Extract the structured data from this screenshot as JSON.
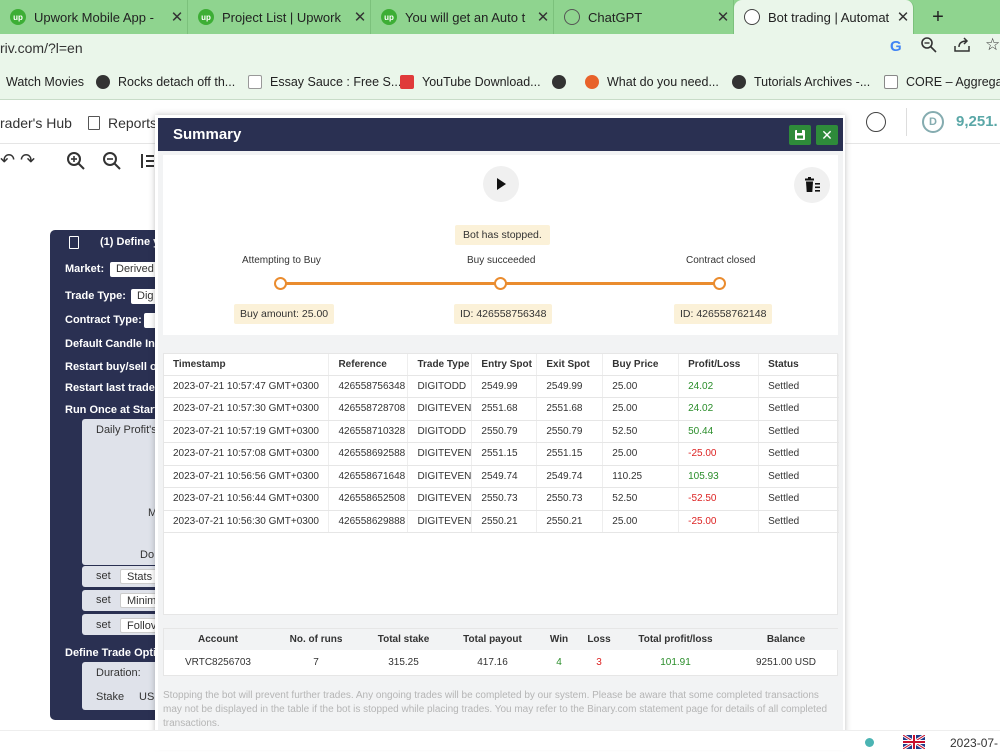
{
  "browser": {
    "tabs": [
      {
        "title": "Upwork Mobile App -",
        "favicon": "upwork-icon"
      },
      {
        "title": "Project List | Upwork",
        "favicon": "upwork-icon"
      },
      {
        "title": "You will get an Auto t",
        "favicon": "upwork-icon"
      },
      {
        "title": "ChatGPT",
        "favicon": "chatgpt-icon"
      },
      {
        "title": "Bot trading | Automat",
        "favicon": "deriv-icon"
      }
    ],
    "new_tab": "+",
    "url": "riv.com/?l=en",
    "bookmarks": [
      {
        "label": "Watch Movies"
      },
      {
        "label": "Rocks detach off th..."
      },
      {
        "label": "Essay Sauce : Free S..."
      },
      {
        "label": "YouTube Download..."
      },
      {
        "label": ""
      },
      {
        "label": "What do you need..."
      },
      {
        "label": "Tutorials Archives -..."
      },
      {
        "label": "CORE – Aggregatin"
      }
    ]
  },
  "app": {
    "nav_traders_hub": "rader's Hub",
    "nav_reports": "Reports",
    "balance": "9,251."
  },
  "workspace": {
    "define_label": "(1) Define y",
    "market_label": "Market:",
    "market_value": "Derived",
    "trade_type_label": "Trade Type:",
    "trade_type_value": "Dig",
    "contract_type_label": "Contract Type:",
    "candle_label": "Default Candle Int",
    "restart_buy_label": "Restart buy/sell or",
    "restart_last_label": "Restart last trade",
    "run_once_label": "Run Once at Start",
    "daily_profit_label": "Daily Profit's",
    "m_label": "M",
    "do_label": "Do",
    "set_items": [
      {
        "set": "set",
        "value": "Stats"
      },
      {
        "set": "set",
        "value": "Minim"
      },
      {
        "set": "set",
        "value": "Follov"
      }
    ],
    "define_trade_label": "Define Trade Optic",
    "duration_label": "Duration:",
    "stake_label": "Stake",
    "stake_value": "US"
  },
  "summary": {
    "title": "Summary",
    "status": "Bot has stopped.",
    "stages": [
      {
        "label": "Attempting to Buy",
        "box": "Buy amount: 25.00"
      },
      {
        "label": "Buy succeeded",
        "box": "ID: 426558756348"
      },
      {
        "label": "Contract closed",
        "box": "ID: 426558762148"
      }
    ],
    "table_headers": [
      "Timestamp",
      "Reference",
      "Trade Type",
      "Entry Spot",
      "Exit Spot",
      "Buy Price",
      "Profit/Loss",
      "Status"
    ],
    "rows": [
      {
        "timestamp": "2023-07-21 10:57:47 GMT+0300",
        "reference": "426558756348",
        "trade_type": "DIGITODD",
        "entry": "2549.99",
        "exit": "2549.99",
        "buy": "25.00",
        "pl": "24.02",
        "status": "Settled"
      },
      {
        "timestamp": "2023-07-21 10:57:30 GMT+0300",
        "reference": "426558728708",
        "trade_type": "DIGITEVEN",
        "entry": "2551.68",
        "exit": "2551.68",
        "buy": "25.00",
        "pl": "24.02",
        "status": "Settled"
      },
      {
        "timestamp": "2023-07-21 10:57:19 GMT+0300",
        "reference": "426558710328",
        "trade_type": "DIGITODD",
        "entry": "2550.79",
        "exit": "2550.79",
        "buy": "52.50",
        "pl": "50.44",
        "status": "Settled"
      },
      {
        "timestamp": "2023-07-21 10:57:08 GMT+0300",
        "reference": "426558692588",
        "trade_type": "DIGITEVEN",
        "entry": "2551.15",
        "exit": "2551.15",
        "buy": "25.00",
        "pl": "-25.00",
        "status": "Settled"
      },
      {
        "timestamp": "2023-07-21 10:56:56 GMT+0300",
        "reference": "426558671648",
        "trade_type": "DIGITEVEN",
        "entry": "2549.74",
        "exit": "2549.74",
        "buy": "110.25",
        "pl": "105.93",
        "status": "Settled"
      },
      {
        "timestamp": "2023-07-21 10:56:44 GMT+0300",
        "reference": "426558652508",
        "trade_type": "DIGITEVEN",
        "entry": "2550.73",
        "exit": "2550.73",
        "buy": "52.50",
        "pl": "-52.50",
        "status": "Settled"
      },
      {
        "timestamp": "2023-07-21 10:56:30 GMT+0300",
        "reference": "426558629888",
        "trade_type": "DIGITEVEN",
        "entry": "2550.21",
        "exit": "2550.21",
        "buy": "25.00",
        "pl": "-25.00",
        "status": "Settled"
      }
    ],
    "totals_headers": [
      "Account",
      "No. of runs",
      "Total stake",
      "Total payout",
      "Win",
      "Loss",
      "Total profit/loss",
      "Balance"
    ],
    "totals": {
      "account": "VRTC8256703",
      "runs": "7",
      "stake": "315.25",
      "payout": "417.16",
      "win": "4",
      "loss": "3",
      "profit": "101.91",
      "balance": "9251.00 USD"
    },
    "disclaimer": "Stopping the bot will prevent further trades. Any ongoing trades will be completed by our system. Please be aware that some completed transactions may not be displayed in the table if the bot is stopped while placing trades. You may refer to the Binary.com statement page for details of all completed transactions."
  },
  "statusbar": {
    "date": "2023-07-"
  },
  "colors": {
    "positive": "#2a8d2a",
    "negative": "#dd2424",
    "accent": "#ea8c2f",
    "header": "#2a3052",
    "save": "#2e8b3a"
  }
}
